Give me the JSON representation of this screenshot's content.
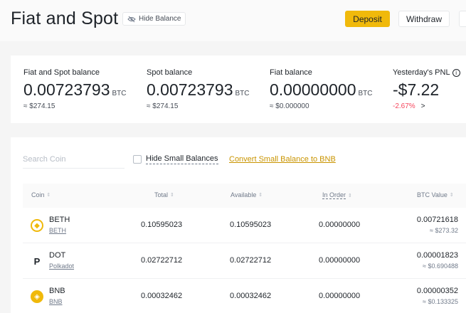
{
  "header": {
    "title": "Fiat and Spot",
    "hide_balance": "Hide Balance",
    "deposit": "Deposit",
    "withdraw": "Withdraw"
  },
  "summary": {
    "fiat_spot": {
      "label": "Fiat and Spot balance",
      "value": "0.00723793",
      "unit": "BTC",
      "usd": "≈ $274.15"
    },
    "spot": {
      "label": "Spot balance",
      "value": "0.00723793",
      "unit": "BTC",
      "usd": "≈ $274.15"
    },
    "fiat": {
      "label": "Fiat balance",
      "value": "0.00000000",
      "unit": "BTC",
      "usd": "≈ $0.000000"
    },
    "pnl": {
      "label": "Yesterday's PNL",
      "value": "-$7.22",
      "percent": "-2.67%"
    }
  },
  "controls": {
    "search_placeholder": "Search Coin",
    "hide_small": "Hide Small Balances",
    "convert": "Convert Small Balance to BNB"
  },
  "table": {
    "headers": {
      "coin": "Coin",
      "total": "Total",
      "available": "Available",
      "in_order": "In Order",
      "btc_value": "BTC Value"
    },
    "rows": [
      {
        "symbol": "BETH",
        "name": "BETH",
        "total": "0.10595023",
        "available": "0.10595023",
        "in_order": "0.00000000",
        "btc": "0.00721618",
        "usd": "≈ $273.32"
      },
      {
        "symbol": "DOT",
        "name": "Polkadot",
        "total": "0.02722712",
        "available": "0.02722712",
        "in_order": "0.00000000",
        "btc": "0.00001823",
        "usd": "≈ $0.690488"
      },
      {
        "symbol": "BNB",
        "name": "BNB",
        "total": "0.00032462",
        "available": "0.00032462",
        "in_order": "0.00000000",
        "btc": "0.00000352",
        "usd": "≈ $0.133325"
      }
    ]
  },
  "colors": {
    "accent": "#f0b90b",
    "negative": "#f6465d",
    "link": "#c99400"
  },
  "icons": {
    "hide_balance": "eye-slash-icon",
    "pnl_info": "info-icon",
    "beth": "beth-coin-icon",
    "dot": "polkadot-coin-icon",
    "bnb": "bnb-coin-icon"
  }
}
